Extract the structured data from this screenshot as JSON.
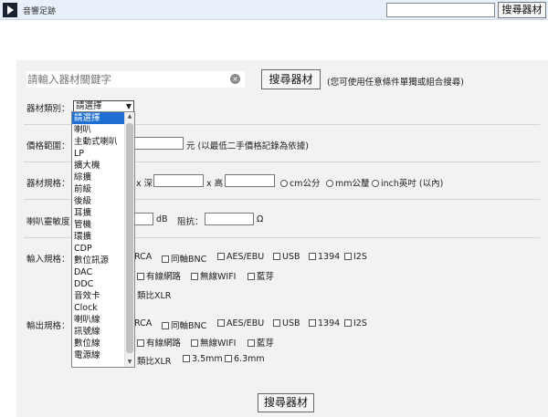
{
  "topbar": {
    "site_title": "音響足跡",
    "search_value": "",
    "search_button": "搜尋器材"
  },
  "search": {
    "placeholder": "請輸入器材關鍵字",
    "clear_glyph": "×",
    "button": "搜尋器材",
    "hint": "(您可使用任意條件單獨或組合搜尋)"
  },
  "category": {
    "label": "器材類別：",
    "selected": "請選擇",
    "options": [
      "請選擇",
      "喇叭",
      "主動式喇叭",
      "LP",
      "擴大機",
      "綜擴",
      "前級",
      "後級",
      "耳擴",
      "管機",
      "環擴",
      "CDP",
      "數位訊源",
      "DAC",
      "DDC",
      "音效卡",
      "Clock",
      "喇叭線",
      "訊號線",
      "數位線",
      "電源線"
    ]
  },
  "price": {
    "label": "價格範圍：",
    "unit": "元 (以最低二手價格記錄為依據)"
  },
  "size": {
    "label": "器材規格：",
    "x_deep": "x 深",
    "x_high": "x 高",
    "units": [
      "cm公分",
      "mm公釐",
      "inch英吋 (以內)"
    ]
  },
  "sensitivity": {
    "label": "喇叭靈敏度",
    "db": "dB",
    "impedance_label": "阻抗：",
    "ohm": "Ω"
  },
  "input_spec": {
    "label": "輸入規格：",
    "row1": [
      "RCA",
      "同軸BNC",
      "AES/EBU",
      "USB",
      "1394",
      "I2S"
    ],
    "row2": [
      "有線網路",
      "無線WIFI",
      "藍芽"
    ],
    "row3_tail": "類比XLR"
  },
  "output_spec": {
    "label": "輸出規格：",
    "row1": [
      "RCA",
      "同軸BNC",
      "AES/EBU",
      "USB",
      "1394",
      "I2S"
    ],
    "row2": [
      "有線網路",
      "無線WIFI",
      "藍芽"
    ],
    "row3": [
      "類比XLR",
      "3.5mm",
      "6.3mm"
    ]
  },
  "colors": {
    "topbar_bg": "#e8f1fb",
    "panel_bg": "#f2f2f2",
    "selection": "#1e6fd1"
  }
}
